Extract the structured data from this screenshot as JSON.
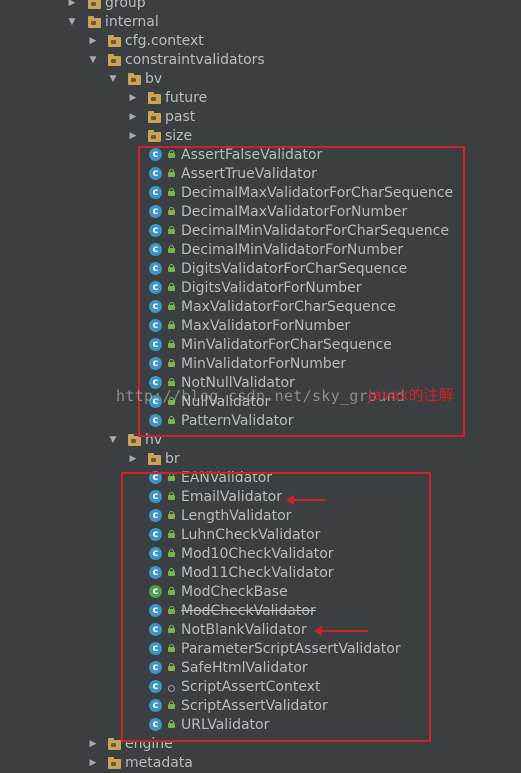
{
  "tree": {
    "group": "group",
    "internal": "internal",
    "cfg_context": "cfg.context",
    "constraintvalidators": "constraintvalidators",
    "bv": "bv",
    "future": "future",
    "past": "past",
    "size": "size",
    "bv_classes": [
      "AssertFalseValidator",
      "AssertTrueValidator",
      "DecimalMaxValidatorForCharSequence",
      "DecimalMaxValidatorForNumber",
      "DecimalMinValidatorForCharSequence",
      "DecimalMinValidatorForNumber",
      "DigitsValidatorForCharSequence",
      "DigitsValidatorForNumber",
      "MaxValidatorForCharSequence",
      "MaxValidatorForNumber",
      "MinValidatorForCharSequence",
      "MinValidatorForNumber",
      "NotNullValidator",
      "NullValidator",
      "PatternValidator"
    ],
    "hv": "hv",
    "br": "br",
    "hv_classes": [
      "EANValidator",
      "EmailValidator",
      "LengthValidator",
      "LuhnCheckValidator",
      "Mod10CheckValidator",
      "Mod11CheckValidator",
      "ModCheckBase",
      "ModCheckValidator",
      "NotBlankValidator",
      "ParameterScriptAssertValidator",
      "SafeHtmlValidator",
      "ScriptAssertContext",
      "ScriptAssertValidator",
      "URLValidator"
    ],
    "engine": "engine",
    "metadata": "metadata"
  },
  "watermark": "http://blog.csdn.net/sky_ground",
  "annotation": "Javax的注解",
  "colors": {
    "background": "#3c3f41",
    "text": "#bbbbbb",
    "highlight_box": "#d0202a",
    "package_folder": "#c9a458",
    "class_icon": "#3e93c8",
    "abstract_class_icon": "#4ea04e",
    "public_lock": "#7cb342"
  },
  "icons": {
    "expanded": "triangle-down-icon",
    "collapsed": "triangle-right-icon",
    "package": "package-folder-icon",
    "class": "class-c-icon",
    "public": "lock-icon"
  }
}
